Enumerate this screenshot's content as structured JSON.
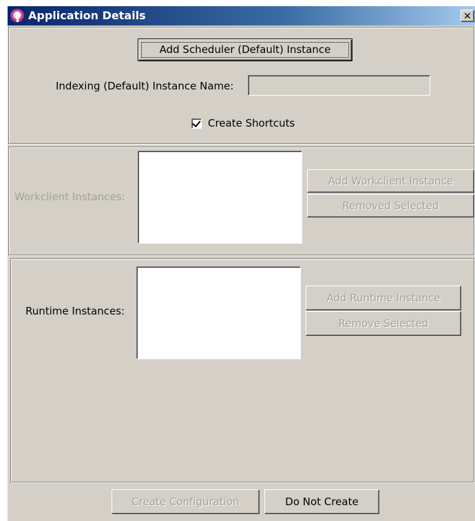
{
  "window": {
    "title": "Application Details",
    "close_glyph": "✕"
  },
  "scheduler": {
    "add_button_label": "Add Scheduler (Default) Instance",
    "indexing_label": "Indexing (Default) Instance Name:",
    "indexing_value": "",
    "create_shortcuts_label": "Create Shortcuts",
    "create_shortcuts_checked": true
  },
  "workclient": {
    "label": "Workclient Instances:",
    "items": [],
    "add_button_label": "Add Workclient Instance",
    "remove_button_label": "Removed Selected"
  },
  "runtime": {
    "label": "Runtime Instances:",
    "items": [],
    "add_button_label": "Add Runtime Instance",
    "remove_button_label": "Remove Selected"
  },
  "footer": {
    "create_button_label": "Create Configuration",
    "do_not_create_button_label": "Do Not Create"
  },
  "colors": {
    "dialog_bg": "#d4d0c8",
    "titlebar_start": "#0a246a",
    "titlebar_end": "#a6caf0",
    "disabled_text": "#a4a094"
  },
  "icons": {
    "app": "app-logo-icon",
    "close": "close-icon",
    "check": "checkmark-icon"
  }
}
